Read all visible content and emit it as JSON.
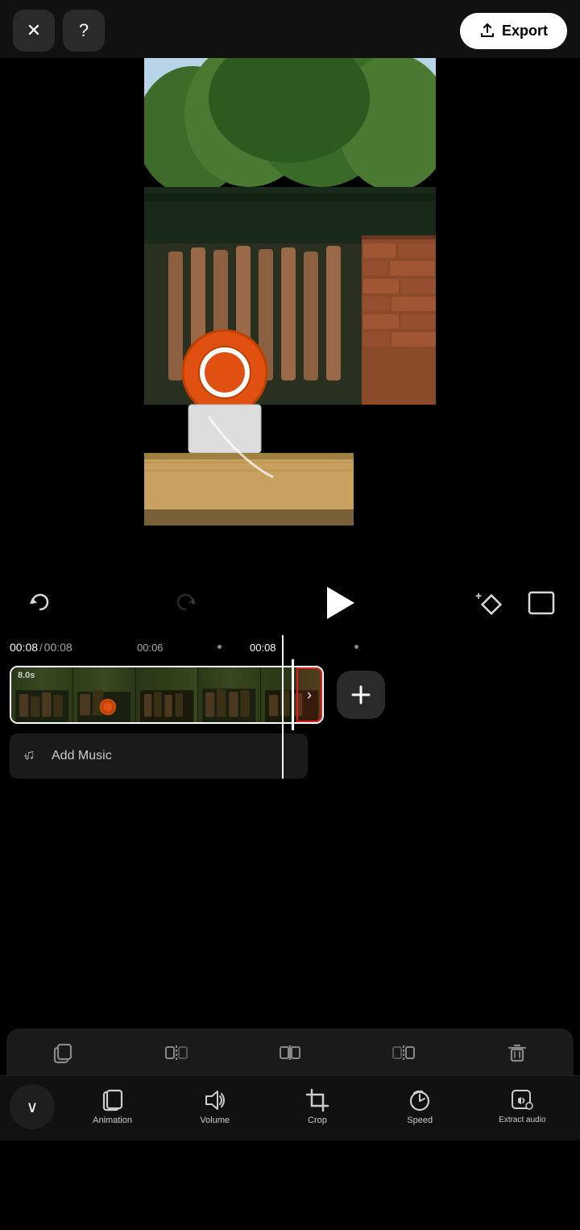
{
  "topBar": {
    "closeLabel": "✕",
    "helpLabel": "?",
    "exportLabel": "Export"
  },
  "playback": {
    "undoLabel": "↩",
    "redoLabel": "↪",
    "playLabel": "▶",
    "currentTime": "00:08",
    "totalTime": "00:08",
    "midTime": "00:06",
    "rightTime": "00:08"
  },
  "timeline": {
    "clipDuration": "8.0s",
    "addMusicLabel": "Add Music"
  },
  "editToolbar": {
    "buttons": [
      {
        "label": ""
      },
      {
        "label": ""
      },
      {
        "label": ""
      },
      {
        "label": ""
      },
      {
        "label": ""
      }
    ]
  },
  "bottomNav": {
    "chevronLabel": "∨",
    "items": [
      {
        "label": "Animation"
      },
      {
        "label": "Volume"
      },
      {
        "label": "Crop"
      },
      {
        "label": "Speed"
      },
      {
        "label": "Extract audio"
      }
    ]
  }
}
